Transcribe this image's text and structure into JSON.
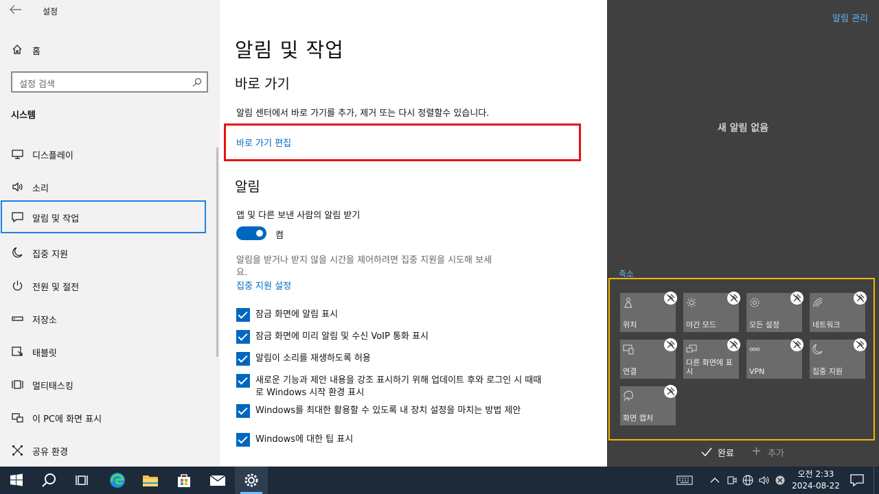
{
  "window": {
    "title": "설정"
  },
  "sidebar": {
    "home_label": "홈",
    "search_placeholder": "설정 검색",
    "section_title": "시스템",
    "items": [
      {
        "label": "디스플레이",
        "icon": "monitor-icon"
      },
      {
        "label": "소리",
        "icon": "speaker-icon"
      },
      {
        "label": "알림 및 작업",
        "icon": "notification-icon",
        "selected": true
      },
      {
        "label": "집중 지원",
        "icon": "moon-icon"
      },
      {
        "label": "전원 및 절전",
        "icon": "power-icon"
      },
      {
        "label": "저장소",
        "icon": "storage-icon"
      },
      {
        "label": "태블릿",
        "icon": "tablet-icon"
      },
      {
        "label": "멀티태스킹",
        "icon": "multitask-icon"
      },
      {
        "label": "이 PC에 화면 표시",
        "icon": "project-icon"
      },
      {
        "label": "공유 환경",
        "icon": "share-icon"
      }
    ]
  },
  "main": {
    "title": "알림 및 작업",
    "shortcuts_heading": "바로 가기",
    "shortcuts_desc": "알림 센터에서 바로 가기를 추가, 제거 또는 다시 정렬할수 있습니다.",
    "shortcuts_edit_link": "바로 가기 편집",
    "notifications_heading": "알림",
    "toggle_label": "앱 및 다른 보낸 사람의 알림 받기",
    "toggle_state": "켬",
    "focus_desc_1": "알림을 받거나 받지 않을 시간을 제어하려면 집중 지원을 시도해 보세",
    "focus_desc_2": "요.",
    "focus_link": "집중 지원 설정",
    "checkboxes": [
      "잠금 화면에 알림 표시",
      "잠금 화면에 미리 알림 및 수신 VoIP 통화 표시",
      "알림이 소리를 재생하도록 허용",
      "새로운 기능과 제안 내용을 강조 표시하기 위해 업데이트 후와 로그인 시 때때로 Windows 시작 환경 표시",
      "Windows를 최대한 활용할 수 있도록 내 장치 설정을 마치는 방법 제안",
      "Windows에 대한 팁 표시"
    ]
  },
  "action_center": {
    "manage_link": "알림 관리",
    "empty_text": "새 알림 없음",
    "collapse_link": "축소",
    "tiles": [
      {
        "label": "위치",
        "icon": "location-icon"
      },
      {
        "label": "야간 모드",
        "icon": "brightness-icon"
      },
      {
        "label": "모든 설정",
        "icon": "gear-icon"
      },
      {
        "label": "네트워크",
        "icon": "network-icon"
      },
      {
        "label": "연결",
        "icon": "connect-icon"
      },
      {
        "label": "다른 화면에 표시",
        "icon": "project-icon"
      },
      {
        "label": "VPN",
        "icon": "vpn-icon"
      },
      {
        "label": "집중 지원",
        "icon": "moon-icon"
      },
      {
        "label": "화면 캡처",
        "icon": "snip-icon"
      }
    ],
    "done_label": "완료",
    "add_label": "추가"
  },
  "taskbar": {
    "time": "오전 2:33",
    "date": "2024-08-22"
  },
  "colors": {
    "accent": "#0067c0",
    "highlight_red": "#e81010",
    "highlight_yellow": "#f5b800",
    "highlight_blue": "#1e7fe0"
  }
}
